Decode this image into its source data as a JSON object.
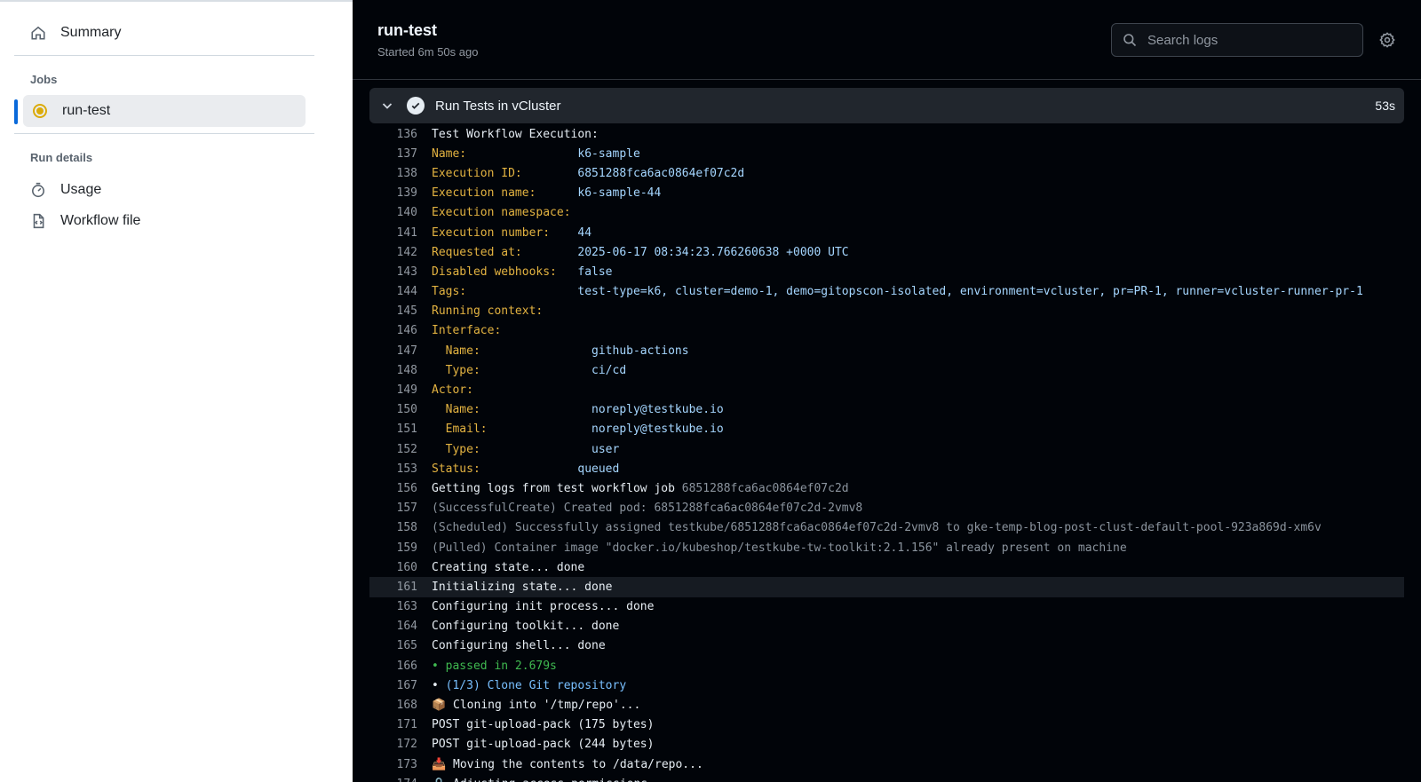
{
  "sidebar": {
    "summary_label": "Summary",
    "jobs_heading": "Jobs",
    "job_label": "run-test",
    "run_details_heading": "Run details",
    "usage_label": "Usage",
    "workflow_file_label": "Workflow file"
  },
  "header": {
    "title": "run-test",
    "subtitle": "Started 6m 50s ago",
    "search_placeholder": "Search logs"
  },
  "step": {
    "title": "Run Tests in vCluster",
    "duration": "53s"
  },
  "log_lines": [
    {
      "n": "136",
      "k": "",
      "v": "Test Workflow Execution:",
      "style": "plain"
    },
    {
      "n": "137",
      "k": "Name:                ",
      "v": "k6-sample",
      "style": "kv"
    },
    {
      "n": "138",
      "k": "Execution ID:        ",
      "v": "6851288fca6ac0864ef07c2d",
      "style": "kv"
    },
    {
      "n": "139",
      "k": "Execution name:      ",
      "v": "k6-sample-44",
      "style": "kv"
    },
    {
      "n": "140",
      "k": "Execution namespace: ",
      "v": "",
      "style": "kv"
    },
    {
      "n": "141",
      "k": "Execution number:    ",
      "v": "44",
      "style": "kv"
    },
    {
      "n": "142",
      "k": "Requested at:        ",
      "v": "2025-06-17 08:34:23.766260638 +0000 UTC",
      "style": "kv"
    },
    {
      "n": "143",
      "k": "Disabled webhooks:   ",
      "v": "false",
      "style": "kv"
    },
    {
      "n": "144",
      "k": "Tags:                ",
      "v": "test-type=k6, cluster=demo-1, demo=gitopscon-isolated, environment=vcluster, pr=PR-1, runner=vcluster-runner-pr-1",
      "style": "kv"
    },
    {
      "n": "145",
      "k": "Running context:",
      "v": "",
      "style": "kv"
    },
    {
      "n": "146",
      "k": "Interface:",
      "v": "",
      "style": "kv"
    },
    {
      "n": "147",
      "k": "  Name:                ",
      "v": "github-actions",
      "style": "kv"
    },
    {
      "n": "148",
      "k": "  Type:                ",
      "v": "ci/cd",
      "style": "kv"
    },
    {
      "n": "149",
      "k": "Actor:",
      "v": "",
      "style": "kv"
    },
    {
      "n": "150",
      "k": "  Name:                ",
      "v": "noreply@testkube.io",
      "style": "kv"
    },
    {
      "n": "151",
      "k": "  Email:               ",
      "v": "noreply@testkube.io",
      "style": "kv"
    },
    {
      "n": "152",
      "k": "  Type:                ",
      "v": "user",
      "style": "kv"
    },
    {
      "n": "153",
      "k": "Status:              ",
      "v": "queued",
      "style": "kv"
    },
    {
      "n": "156",
      "k": "Getting logs from test workflow job ",
      "v": "6851288fca6ac0864ef07c2d",
      "style": "plain-dim"
    },
    {
      "n": "157",
      "k": "",
      "v": "(SuccessfulCreate) Created pod: 6851288fca6ac0864ef07c2d-2vmv8",
      "style": "dim"
    },
    {
      "n": "158",
      "k": "",
      "v": "(Scheduled) Successfully assigned testkube/6851288fca6ac0864ef07c2d-2vmv8 to gke-temp-blog-post-clust-default-pool-923a869d-xm6v",
      "style": "dim"
    },
    {
      "n": "159",
      "k": "",
      "v": "(Pulled) Container image \"docker.io/kubeshop/testkube-tw-toolkit:2.1.156\" already present on machine",
      "style": "dim"
    },
    {
      "n": "160",
      "k": "",
      "v": "Creating state... done",
      "style": "plain"
    },
    {
      "n": "161",
      "k": "",
      "v": "Initializing state... done",
      "style": "plain-hl"
    },
    {
      "n": "163",
      "k": "",
      "v": "Configuring init process... done",
      "style": "plain"
    },
    {
      "n": "164",
      "k": "",
      "v": "Configuring toolkit... done",
      "style": "plain"
    },
    {
      "n": "165",
      "k": "",
      "v": "Configuring shell... done",
      "style": "plain"
    },
    {
      "n": "166",
      "k": "",
      "v": "• passed in 2.679s",
      "style": "green"
    },
    {
      "n": "167",
      "k": "• ",
      "v": "(1/3) Clone Git repository",
      "style": "bullet-cyan"
    },
    {
      "n": "168",
      "k": "",
      "v": "📦 Cloning into '/tmp/repo'...",
      "style": "plain"
    },
    {
      "n": "171",
      "k": "",
      "v": "POST git-upload-pack (175 bytes)",
      "style": "plain"
    },
    {
      "n": "172",
      "k": "",
      "v": "POST git-upload-pack (244 bytes)",
      "style": "plain"
    },
    {
      "n": "173",
      "k": "",
      "v": "📥 Moving the contents to /data/repo...",
      "style": "plain"
    },
    {
      "n": "174",
      "k": "",
      "v": "🔒 Adjusting access permissions...",
      "style": "plain"
    }
  ],
  "colors": {
    "accent": "#0969da",
    "key": "#e3b341",
    "value": "#a5d6ff",
    "success": "#3fb950",
    "pending": "#dbab0a"
  }
}
